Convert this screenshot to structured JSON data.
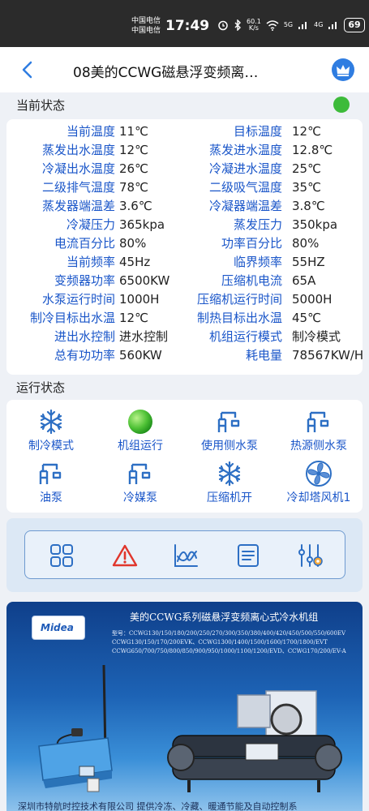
{
  "status_bar": {
    "carrier_1": "中国电信",
    "carrier_2": "中国电信",
    "time": "17:49",
    "speed_value": "60.1",
    "speed_unit": "K/s",
    "net_1": "5G",
    "net_2": "4G",
    "battery": "69"
  },
  "header": {
    "title": "08美的CCWG磁悬浮变频离…"
  },
  "current_status": {
    "title": "当前状态",
    "indicator_color": "#3dbb3a",
    "rows": [
      {
        "label": "当前温度",
        "value": "11℃",
        "label2": "目标温度",
        "value2": "12℃"
      },
      {
        "label": "蒸发出水温度",
        "value": "12℃",
        "label2": "蒸发进水温度",
        "value2": "12.8℃"
      },
      {
        "label": "冷凝出水温度",
        "value": "26℃",
        "label2": "冷凝进水温度",
        "value2": "25℃"
      },
      {
        "label": "二级排气温度",
        "value": "78℃",
        "label2": "二级吸气温度",
        "value2": "35℃"
      },
      {
        "label": "蒸发器端温差",
        "value": "3.6℃",
        "label2": "冷凝器端温差",
        "value2": "3.8℃"
      },
      {
        "label": "冷凝压力",
        "value": "365kpa",
        "label2": "蒸发压力",
        "value2": "350kpa"
      },
      {
        "label": "电流百分比",
        "value": "80%",
        "label2": "功率百分比",
        "value2": "80%"
      },
      {
        "label": "当前频率",
        "value": "45Hz",
        "label2": "临界频率",
        "value2": "55HZ"
      },
      {
        "label": "变频器功率",
        "value": "6500KW",
        "label2": "压缩机电流",
        "value2": "65A"
      },
      {
        "label": "水泵运行时间",
        "value": "1000H",
        "label2": "压缩机运行时间",
        "value2": "5000H"
      },
      {
        "label": "制冷目标出水温",
        "value": "12℃",
        "label2": "制热目标出水温",
        "value2": "45℃"
      },
      {
        "label": "进出水控制",
        "value": "进水控制",
        "label2": "机组运行模式",
        "value2": "制冷模式"
      },
      {
        "label": "总有功功率",
        "value": "560KW",
        "label2": "耗电量",
        "value2": "78567KW/H"
      }
    ]
  },
  "run_status": {
    "title": "运行状态",
    "items": [
      {
        "label": "制冷模式",
        "icon": "snowflake-icon"
      },
      {
        "label": "机组运行",
        "icon": "green-ball-icon"
      },
      {
        "label": "使用侧水泵",
        "icon": "water-pump-icon"
      },
      {
        "label": "热源侧水泵",
        "icon": "water-pump-icon"
      },
      {
        "label": "油泵",
        "icon": "water-pump-icon"
      },
      {
        "label": "冷媒泵",
        "icon": "water-pump-icon"
      },
      {
        "label": "压缩机开",
        "icon": "snowflake-icon"
      },
      {
        "label": "冷却塔风机1",
        "icon": "fan-icon"
      }
    ]
  },
  "toolbar": {
    "items": [
      "grid-icon",
      "alarm-icon",
      "chart-icon",
      "list-icon",
      "settings-sliders-icon"
    ],
    "accent_color": "#2d6fc4",
    "alarm_color": "#e0362c"
  },
  "banner": {
    "logo_text": "Midea",
    "title": "美的CCWG系列磁悬浮变频离心式冷水机组",
    "models": [
      "型号：CCWG130/150/180/200/250/270/300/350/380/400/420/450/500/550/600EV",
      "CCWG130/150/170/200EVK、CCWG1300/1400/1500/1600/1700/1800/EVT",
      "CCWG650/700/750/800/850/900/950/1000/1100/1200/EVD、CCWG170/200/EV-A"
    ],
    "footer": "深圳市特航时控技术有限公司    提供冷冻、冷藏、暖通节能及自动控制系"
  }
}
